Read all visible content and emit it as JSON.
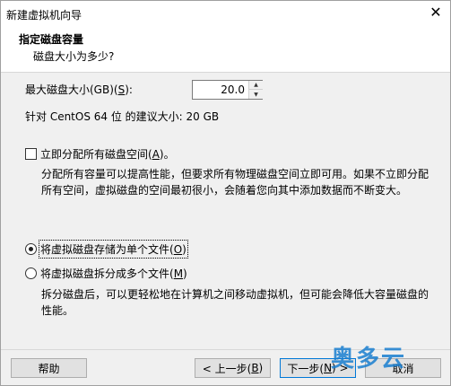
{
  "window": {
    "title": "新建虚拟机向导"
  },
  "header": {
    "title": "指定磁盘容量",
    "subtitle": "磁盘大小为多少?"
  },
  "disk_size": {
    "label_prefix": "最大磁盘大小(GB)(",
    "label_key": "S",
    "label_suffix": "):",
    "value": "20.0"
  },
  "recommendation": "针对 CentOS 64 位 的建议大小: 20 GB",
  "allocate_now": {
    "label_prefix": "立即分配所有磁盘空间(",
    "label_key": "A",
    "label_suffix": ")。",
    "checked": false,
    "description": "分配所有容量可以提高性能，但要求所有物理磁盘空间立即可用。如果不立即分配所有空间，虚拟磁盘的空间最初很小，会随着您向其中添加数据而不断变大。"
  },
  "storage_options": [
    {
      "label_prefix": "将虚拟磁盘存储为单个文件(",
      "label_key": "O",
      "label_suffix": ")",
      "selected": true
    },
    {
      "label_prefix": "将虚拟磁盘拆分成多个文件(",
      "label_key": "M",
      "label_suffix": ")",
      "selected": false
    }
  ],
  "split_description": "拆分磁盘后，可以更轻松地在计算机之间移动虚拟机，但可能会降低大容量磁盘的性能。",
  "buttons": {
    "help": "帮助",
    "prev_prefix": "< 上一步(",
    "prev_key": "B",
    "prev_suffix": ")",
    "next_prefix": "下一步(",
    "next_key": "N",
    "next_suffix": ") >",
    "cancel": "取消"
  },
  "watermark": "奥多云"
}
